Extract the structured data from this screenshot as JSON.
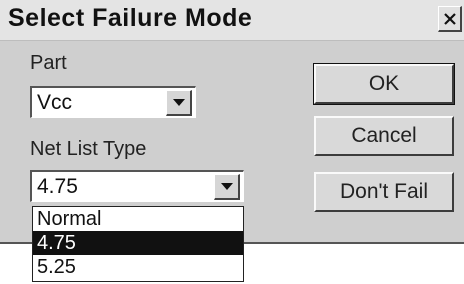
{
  "window": {
    "title": "Select Failure Mode",
    "close_icon": "close-x-icon"
  },
  "part": {
    "label": "Part",
    "selected": "Vcc"
  },
  "net_list_type": {
    "label": "Net List Type",
    "selected": "4.75",
    "options": [
      "Normal",
      "4.75",
      "5.25"
    ],
    "highlighted_index": 1
  },
  "buttons": {
    "ok": "OK",
    "cancel": "Cancel",
    "dont_fail": "Don't Fail"
  }
}
